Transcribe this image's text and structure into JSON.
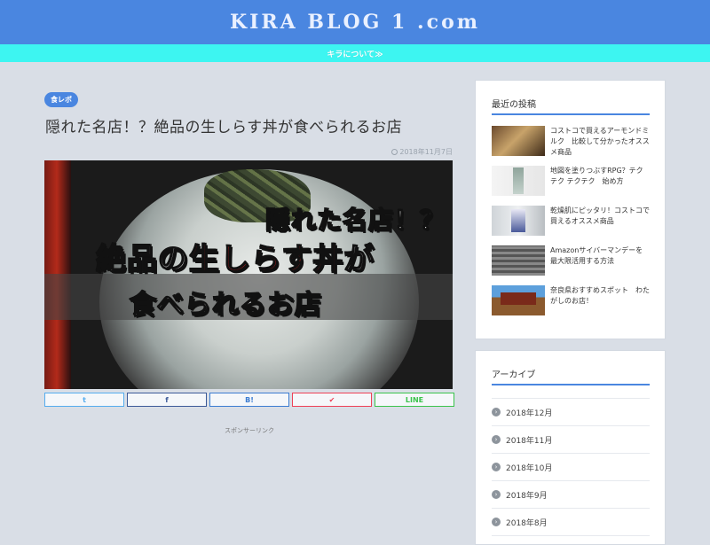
{
  "header": {
    "site_title": "KIRA BLOG 1 .com"
  },
  "subnav": {
    "about_label": "キラについて≫"
  },
  "post": {
    "category": "食レポ",
    "title": "隠れた名店！？絶品の生しらす丼が食べられるお店",
    "date": "2018年11月7日",
    "hero": {
      "line1": "隠れた名店！？",
      "line2_pre": "絶品の",
      "line2_red": "生しらす丼",
      "line2_post": "が",
      "line3": "食べられるお店"
    },
    "share": {
      "twitter": "t",
      "facebook": "f",
      "hatena": "B!",
      "pocket": "✔",
      "line": "LINE"
    },
    "sponsor_label": "スポンサーリンク"
  },
  "sidebar": {
    "recent": {
      "title": "最近の投稿",
      "items": [
        {
          "text": "コストコで買えるアーモンドミルク　比較して分かったオススメ商品"
        },
        {
          "text": "地図を塗りつぶすRPG？テクテク テクテク　始め方"
        },
        {
          "text": "乾燥肌にピッタリ！コストコで買えるオススメ商品"
        },
        {
          "text": "Amazonサイバーマンデーを最大限活用する方法"
        },
        {
          "text": "奈良県おすすめスポット　わたがしのお店！"
        }
      ]
    },
    "archive": {
      "title": "アーカイブ",
      "items": [
        {
          "label": "2018年12月"
        },
        {
          "label": "2018年11月"
        },
        {
          "label": "2018年10月"
        },
        {
          "label": "2018年9月"
        },
        {
          "label": "2018年8月"
        }
      ]
    }
  },
  "colors": {
    "header": "#4a86e0",
    "subnav": "#3df5f1",
    "background": "#d9dee6"
  }
}
